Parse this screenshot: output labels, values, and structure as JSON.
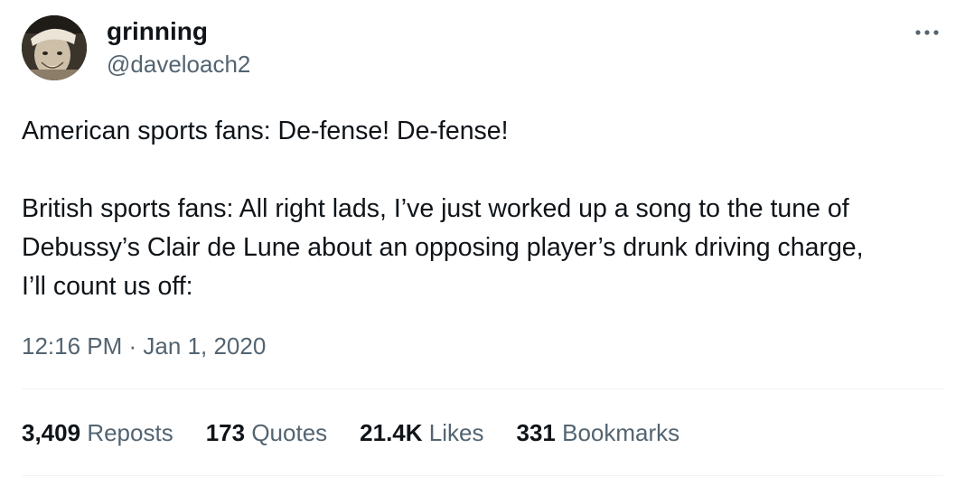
{
  "author": {
    "display_name": "grinning",
    "handle": "@daveloach2",
    "avatar_icon": "avatar-photo"
  },
  "menu": {
    "more_icon": "more-horizontal-icon"
  },
  "tweet": {
    "paragraphs": [
      "American sports fans: De-fense! De-fense!",
      "British sports fans: All right lads, I’ve just worked up a song to the tune of",
      "Debussy’s Clair de Lune about an opposing player’s drunk driving charge,",
      "I’ll count us off:"
    ],
    "timestamp": "12:16 PM · Jan 1, 2020"
  },
  "stats": {
    "reposts": {
      "count": "3,409",
      "label": "Reposts"
    },
    "quotes": {
      "count": "173",
      "label": "Quotes"
    },
    "likes": {
      "count": "21.4K",
      "label": "Likes"
    },
    "bookmarks": {
      "count": "331",
      "label": "Bookmarks"
    }
  },
  "colors": {
    "primary_text": "#0f1419",
    "secondary_text": "#536471",
    "divider": "#eff3f4"
  }
}
